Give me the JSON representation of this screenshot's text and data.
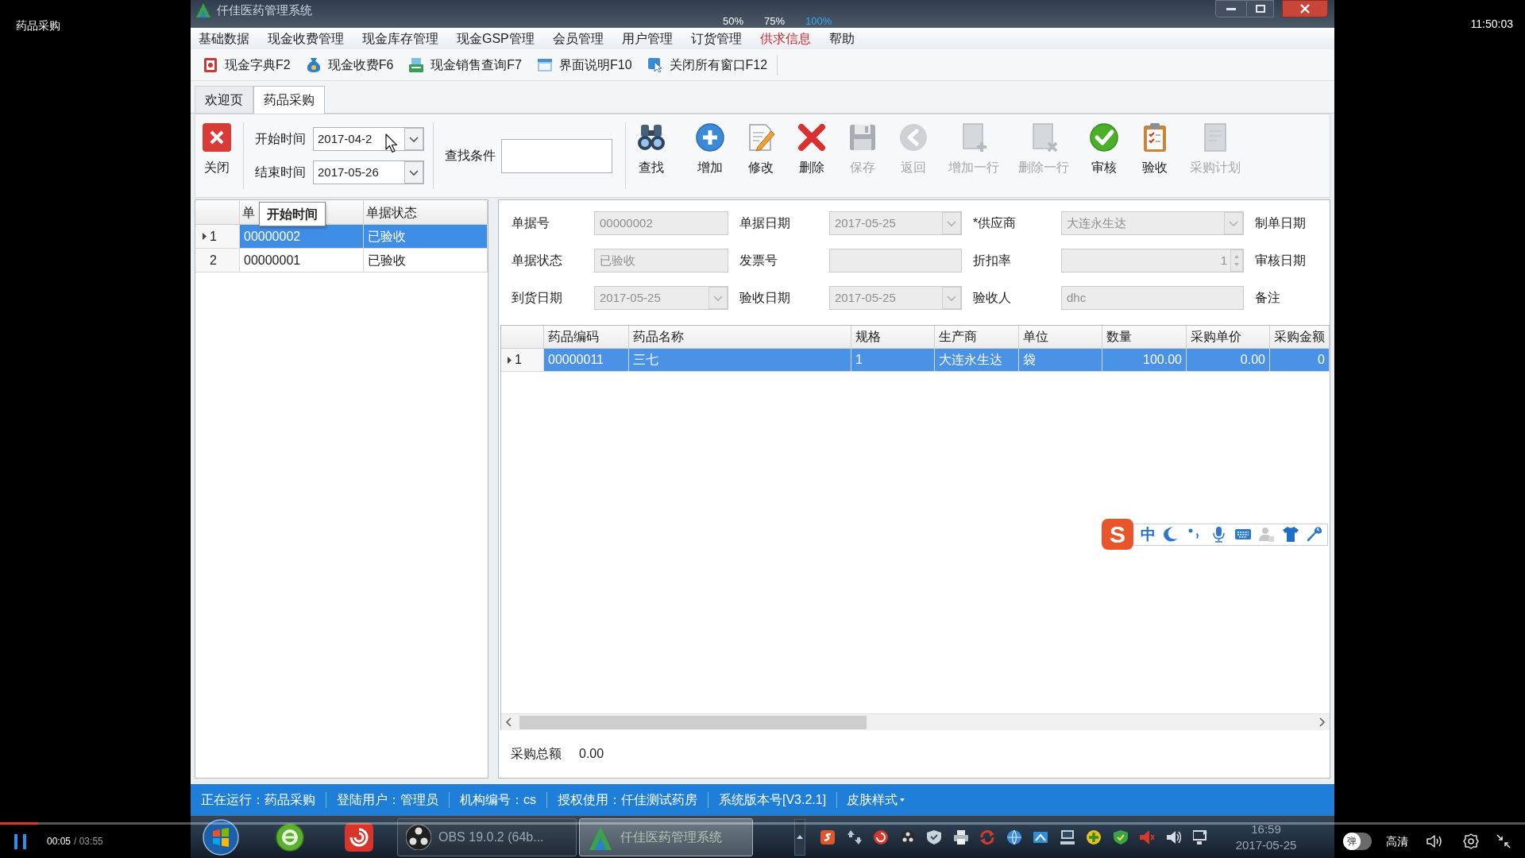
{
  "player": {
    "title": "药品采购",
    "clock": "11:50:03",
    "zoom_options": [
      {
        "label": "50%",
        "selected": false
      },
      {
        "label": "75%",
        "selected": false
      },
      {
        "label": "100%",
        "selected": true
      }
    ],
    "playing": true,
    "level": 0.025,
    "time": "00:05",
    "duration": "/ 03:55",
    "danmaku": "弹",
    "quality": "高清"
  },
  "window": {
    "title": "仟佳医药管理系统"
  },
  "menu": [
    {
      "label": "基础数据",
      "highlighted": false
    },
    {
      "label": "现金收费管理",
      "highlighted": false
    },
    {
      "label": "现金库存管理",
      "highlighted": false
    },
    {
      "label": "现金GSP管理",
      "highlighted": false
    },
    {
      "label": "会员管理",
      "highlighted": false
    },
    {
      "label": "用户管理",
      "highlighted": false
    },
    {
      "label": "订货管理",
      "highlighted": false
    },
    {
      "label": "供求信息",
      "highlighted": true
    },
    {
      "label": "帮助",
      "highlighted": false
    }
  ],
  "quick_bar": [
    "现金字典F2",
    "现金收费F6",
    "现金销售查询F7",
    "界面说明F10",
    "关闭所有窗口F12"
  ],
  "tabs": [
    {
      "label": "欢迎页",
      "selected": false
    },
    {
      "label": "药品采购",
      "selected": true
    }
  ],
  "toolbar": {
    "close": "关闭",
    "start": {
      "label": "开始时间",
      "value": "2017-04-2"
    },
    "end": {
      "label": "结束时间",
      "value": "2017-05-26"
    },
    "search_label": "查找条件",
    "buttons": [
      {
        "label": "查找",
        "disabled": false
      },
      {
        "label": "增加",
        "disabled": false
      },
      {
        "label": "修改",
        "disabled": false
      },
      {
        "label": "删除",
        "disabled": false
      },
      {
        "label": "保存",
        "disabled": true
      },
      {
        "label": "返回",
        "disabled": true
      },
      {
        "label": "增加一行",
        "disabled": true
      },
      {
        "label": "删除一行",
        "disabled": true
      },
      {
        "label": "审核",
        "disabled": false
      },
      {
        "label": "验收",
        "disabled": false
      },
      {
        "label": "采购计划",
        "disabled": true
      }
    ]
  },
  "order_list": {
    "columns": [
      "单",
      "单据状态"
    ],
    "tooltip": "开始时间",
    "rows": [
      {
        "number": "1",
        "code": "00000002",
        "status": "已验收",
        "selected": true
      },
      {
        "number": "2",
        "code": "00000001",
        "status": "已验收",
        "selected": false
      }
    ]
  },
  "form": [
    [
      {
        "label": "单据号",
        "kind": "text",
        "value": "00000002",
        "disabled": true
      },
      {
        "label": "单据日期",
        "kind": "dropdown",
        "value": "2017-05-25",
        "disabled": true
      },
      {
        "label": "*供应商",
        "kind": "dropdown",
        "value": "大连永生达",
        "disabled": true
      },
      {
        "label": "制单日期"
      }
    ],
    [
      {
        "label": "单据状态",
        "kind": "text",
        "value": "已验收",
        "disabled": true
      },
      {
        "label": "发票号",
        "kind": "text",
        "disabled": true
      },
      {
        "label": "折扣率",
        "kind": "spinner",
        "value": "1",
        "disabled": true
      },
      {
        "label": "审核日期"
      }
    ],
    [
      {
        "label": "到货日期",
        "kind": "dropdown",
        "value": "2017-05-25",
        "disabled": true
      },
      {
        "label": "验收日期",
        "kind": "dropdown",
        "value": "2017-05-25",
        "disabled": true
      },
      {
        "label": "验收人",
        "kind": "text",
        "value": "dhc",
        "disabled": true
      },
      {
        "label": "备注"
      }
    ]
  ],
  "items_table": {
    "columns": [
      "药品编码",
      "药品名称",
      "规格",
      "生产商",
      "单位",
      "数量",
      "采购单价",
      "采购金额"
    ],
    "rows": [
      {
        "number": "1",
        "selected": true,
        "cells": [
          "00000011",
          "三七",
          "1",
          "大连永生达",
          "袋",
          "100.00",
          "0.00",
          "0"
        ]
      }
    ]
  },
  "total": {
    "label": "采购总额",
    "value": "0.00"
  },
  "ime_bar": {
    "logo": "S",
    "mode": "中"
  },
  "status_bar": [
    "正在运行：药品采购",
    "登陆用户：管理员",
    "机构编号：cs",
    "授权使用：仟佳测试药房",
    "系统版本号[V3.2.1]",
    "皮肤样式"
  ],
  "taskbar": {
    "windows": [
      {
        "label": "OBS 19.0.2 (64b...",
        "selected": false
      },
      {
        "label": "仟佳医药管理系统",
        "selected": true
      }
    ],
    "time": "16:59",
    "date": "2017-05-25"
  }
}
